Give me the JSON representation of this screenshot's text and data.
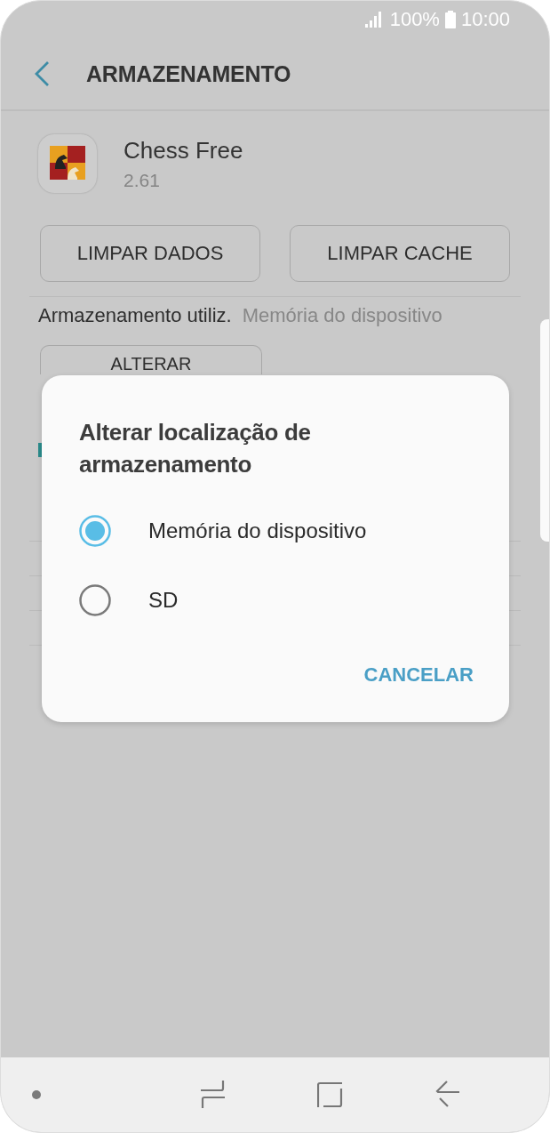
{
  "status_bar": {
    "battery": "100%",
    "time": "10:00"
  },
  "header": {
    "title": "ARMAZENAMENTO"
  },
  "app": {
    "name": "Chess Free",
    "version": "2.61"
  },
  "buttons": [
    "LIMPAR DADOS",
    "LIMPAR CACHE"
  ],
  "storage_used": {
    "label": "Armazenamento utiliz.",
    "value": "Memória do dispositivo"
  },
  "change_button": "ALTERAR",
  "dialog": {
    "title": "Alterar localização de armazenamento",
    "options": [
      {
        "label": "Memória do dispositivo",
        "selected": true
      },
      {
        "label": "SD",
        "selected": false
      }
    ],
    "cancel": "CANCELAR"
  }
}
